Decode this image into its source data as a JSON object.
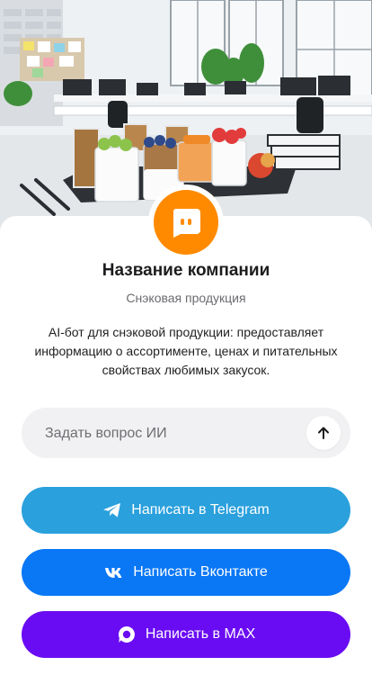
{
  "hero": {
    "image": "office-snack-jars-illustration"
  },
  "company": {
    "logo_icon": "bot-face-icon",
    "logo_color": "#ff8a00",
    "name": "Название компании",
    "subtitle": "Снэковая продукция",
    "description": "AI-бот для снэковой продукции: предоставляет информацию о ассортименте, ценах и питательных свойствах любимых закусок."
  },
  "ask": {
    "placeholder": "Задать вопрос ИИ",
    "value": "",
    "send_icon": "arrow-up-icon"
  },
  "buttons": {
    "telegram": {
      "label": "Написать в Telegram",
      "icon": "telegram-icon",
      "color": "#2aa0dd"
    },
    "vk": {
      "label": "Написать Вконтакте",
      "icon": "vk-icon",
      "color": "#0a77f5"
    },
    "max": {
      "label": "Написать в MAX",
      "icon": "max-icon",
      "color": "#6a0cf3"
    }
  }
}
